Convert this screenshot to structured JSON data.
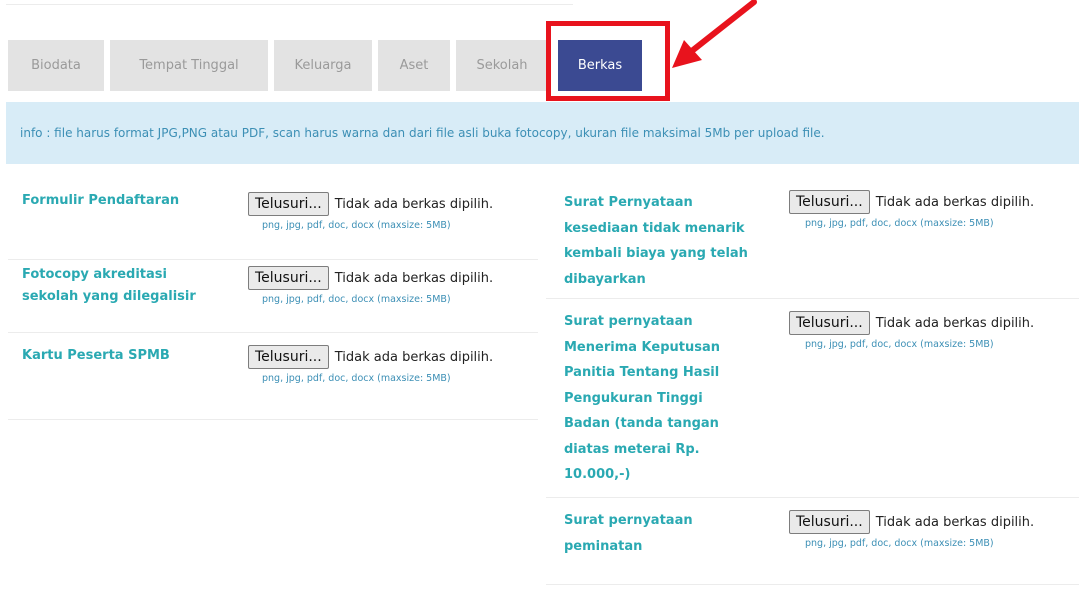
{
  "tabs": [
    {
      "label": "Biodata",
      "active": false
    },
    {
      "label": "Tempat Tinggal",
      "active": false
    },
    {
      "label": "Keluarga",
      "active": false
    },
    {
      "label": "Aset",
      "active": false
    },
    {
      "label": "Sekolah",
      "active": false
    },
    {
      "label": "Berkas",
      "active": true
    }
  ],
  "info": "info : file harus format JPG,PNG atau PDF, scan harus warna dan dari file asli buka fotocopy, ukuran file maksimal 5Mb per upload file.",
  "upload": {
    "browse_label": "Telusuri...",
    "no_file_text": "Tidak ada berkas dipilih.",
    "hint": "png, jpg, pdf, doc, docx (maxsize: 5MB)"
  },
  "left_fields": [
    {
      "label": "Formulir Pendaftaran"
    },
    {
      "label": "Fotocopy akreditasi sekolah yang dilegalisir"
    },
    {
      "label": "Kartu Peserta SPMB"
    }
  ],
  "right_fields": [
    {
      "label": "Surat Pernyataan kesediaan tidak menarik kembali biaya yang telah dibayarkan"
    },
    {
      "label": "Surat pernyataan Menerima Keputusan Panitia Tentang Hasil Pengukuran Tinggi Badan (tanda tangan diatas meterai Rp. 10.000,-)"
    },
    {
      "label": "Surat pernyataan peminatan"
    }
  ],
  "colors": {
    "active_tab": "#3b4a92",
    "inactive_tab": "#e3e3e3",
    "label": "#2aa9b2",
    "info_bg": "#d8ecf7",
    "info_text": "#3c8fb5",
    "annotation": "#e8131d"
  }
}
